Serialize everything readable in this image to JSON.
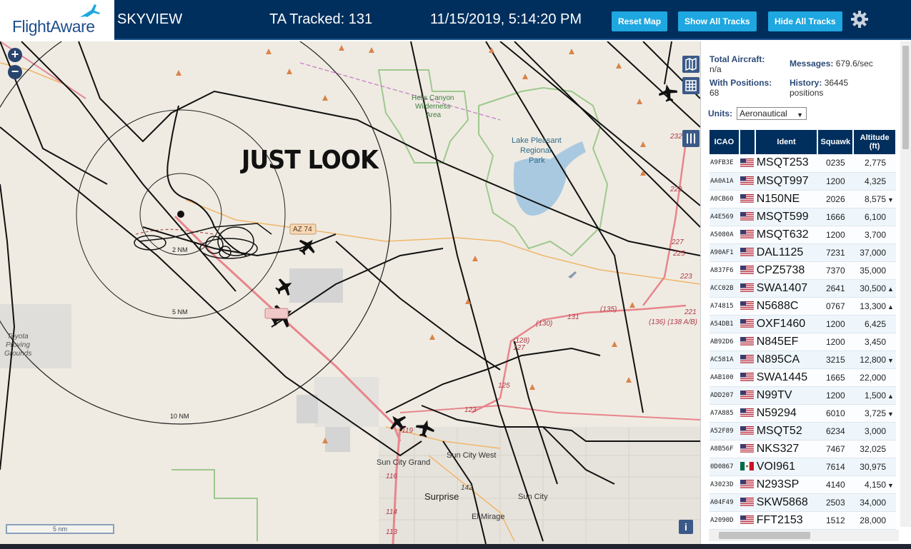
{
  "header": {
    "logo_text": "FlightAware",
    "app_name": "SKYVIEW",
    "tracked": "TA Tracked: 131",
    "datetime": "11/15/2019, 5:14:20 PM",
    "buttons": {
      "reset": "Reset Map",
      "show_all": "Show All Tracks",
      "hide_all": "Hide All Tracks"
    }
  },
  "map": {
    "overlay_text": "JUST LOOK",
    "scale_label": "5 nm",
    "zoom_in": "+",
    "zoom_out": "−",
    "info": "i",
    "labels": {
      "hells_canyon": "Hells Canyon",
      "wilderness": "Wilderness",
      "area": "Area",
      "lake_pleasant": "Lake Pleasant",
      "regional": "Regional",
      "park": "Park",
      "az74": "AZ 74",
      "ring2": "2 NM",
      "ring5": "5 NM",
      "ring10": "10 NM",
      "toyota": "Toyota",
      "proving": "Proving",
      "grounds": "Grounds",
      "sun_city_west": "Sun City West",
      "sun_city_grand": "Sun City Grand",
      "surprise": "Surprise",
      "sun_city": "Sun City",
      "el_mirage": "El Mirage",
      "r131": "131",
      "r135": "(135)",
      "r136": "(136) (138 A/B)",
      "r130": "(130)",
      "r128": "(128)",
      "r127": "127",
      "r125": "125",
      "r123": "123",
      "r119": "119",
      "r116": "116",
      "r114": "114",
      "r113": "113",
      "r142": "142",
      "r232": "232",
      "r229": "229",
      "r227": "227",
      "r225": "225",
      "r223": "223",
      "r221": "221"
    }
  },
  "stats": {
    "total_label": "Total Aircraft:",
    "total_value": "n/a",
    "messages_label": "Messages:",
    "messages_value": "679.6/sec",
    "positions_label": "With Positions:",
    "positions_value": "68",
    "history_label": "History:",
    "history_value": "36445",
    "history_unit": "positions",
    "units_label": "Units:",
    "units_value": "Aeronautical"
  },
  "table": {
    "headers": {
      "icao": "ICAO",
      "ident": "Ident",
      "squawk": "Squawk",
      "altitude": "Altitude",
      "altitude_unit": "(ft)"
    },
    "rows": [
      {
        "icao": "A9FB3E",
        "flag": "us",
        "ident": "MSQT253",
        "squawk": "0235",
        "altitude": "2,775",
        "trend": ""
      },
      {
        "icao": "AA0A1A",
        "flag": "us",
        "ident": "MSQT997",
        "squawk": "1200",
        "altitude": "4,325",
        "trend": ""
      },
      {
        "icao": "A0CB60",
        "flag": "us",
        "ident": "N150NE",
        "squawk": "2026",
        "altitude": "8,575",
        "trend": "▼"
      },
      {
        "icao": "A4E569",
        "flag": "us",
        "ident": "MSQT599",
        "squawk": "1666",
        "altitude": "6,100",
        "trend": ""
      },
      {
        "icao": "A5080A",
        "flag": "us",
        "ident": "MSQT632",
        "squawk": "1200",
        "altitude": "3,700",
        "trend": ""
      },
      {
        "icao": "A90AF1",
        "flag": "us",
        "ident": "DAL1125",
        "squawk": "7231",
        "altitude": "37,000",
        "trend": ""
      },
      {
        "icao": "A837F6",
        "flag": "us",
        "ident": "CPZ5738",
        "squawk": "7370",
        "altitude": "35,000",
        "trend": ""
      },
      {
        "icao": "ACC02B",
        "flag": "us",
        "ident": "SWA1407",
        "squawk": "2641",
        "altitude": "30,500",
        "trend": "▲"
      },
      {
        "icao": "A74815",
        "flag": "us",
        "ident": "N5688C",
        "squawk": "0767",
        "altitude": "13,300",
        "trend": "▲"
      },
      {
        "icao": "A54DB1",
        "flag": "us",
        "ident": "OXF1460",
        "squawk": "1200",
        "altitude": "6,425",
        "trend": ""
      },
      {
        "icao": "AB92D6",
        "flag": "us",
        "ident": "N845EF",
        "squawk": "1200",
        "altitude": "3,450",
        "trend": ""
      },
      {
        "icao": "AC581A",
        "flag": "us",
        "ident": "N895CA",
        "squawk": "3215",
        "altitude": "12,800",
        "trend": "▼"
      },
      {
        "icao": "AAB100",
        "flag": "us",
        "ident": "SWA1445",
        "squawk": "1665",
        "altitude": "22,000",
        "trend": ""
      },
      {
        "icao": "ADD207",
        "flag": "us",
        "ident": "N99TV",
        "squawk": "1200",
        "altitude": "1,500",
        "trend": "▲"
      },
      {
        "icao": "A7A885",
        "flag": "us",
        "ident": "N59294",
        "squawk": "6010",
        "altitude": "3,725",
        "trend": "▼"
      },
      {
        "icao": "A52F89",
        "flag": "us",
        "ident": "MSQT52",
        "squawk": "6234",
        "altitude": "3,000",
        "trend": ""
      },
      {
        "icao": "A8B56F",
        "flag": "us",
        "ident": "NKS327",
        "squawk": "7467",
        "altitude": "32,025",
        "trend": ""
      },
      {
        "icao": "0D0867",
        "flag": "mx",
        "ident": "VOI961",
        "squawk": "7614",
        "altitude": "30,975",
        "trend": ""
      },
      {
        "icao": "A3023D",
        "flag": "us",
        "ident": "N293SP",
        "squawk": "4140",
        "altitude": "4,150",
        "trend": "▼"
      },
      {
        "icao": "A04F49",
        "flag": "us",
        "ident": "SKW5868",
        "squawk": "2503",
        "altitude": "34,000",
        "trend": ""
      },
      {
        "icao": "A2090D",
        "flag": "us",
        "ident": "FFT2153",
        "squawk": "1512",
        "altitude": "28,000",
        "trend": ""
      }
    ]
  },
  "icons": {
    "logo": "plane-logo-icon",
    "settings": "gear-icon",
    "map_layers": "map-icon",
    "grid": "grid-icon",
    "columns": "columns-icon",
    "aircraft": "aircraft-icon",
    "info": "info-icon"
  },
  "colors": {
    "header_bg": "#002f5d",
    "button_bg": "#1ea7e0",
    "map_bg": "#efebe2",
    "water": "#a9c9e0",
    "park_border": "#9ec88e",
    "highway": "#e08a9a",
    "track": "#111111"
  }
}
